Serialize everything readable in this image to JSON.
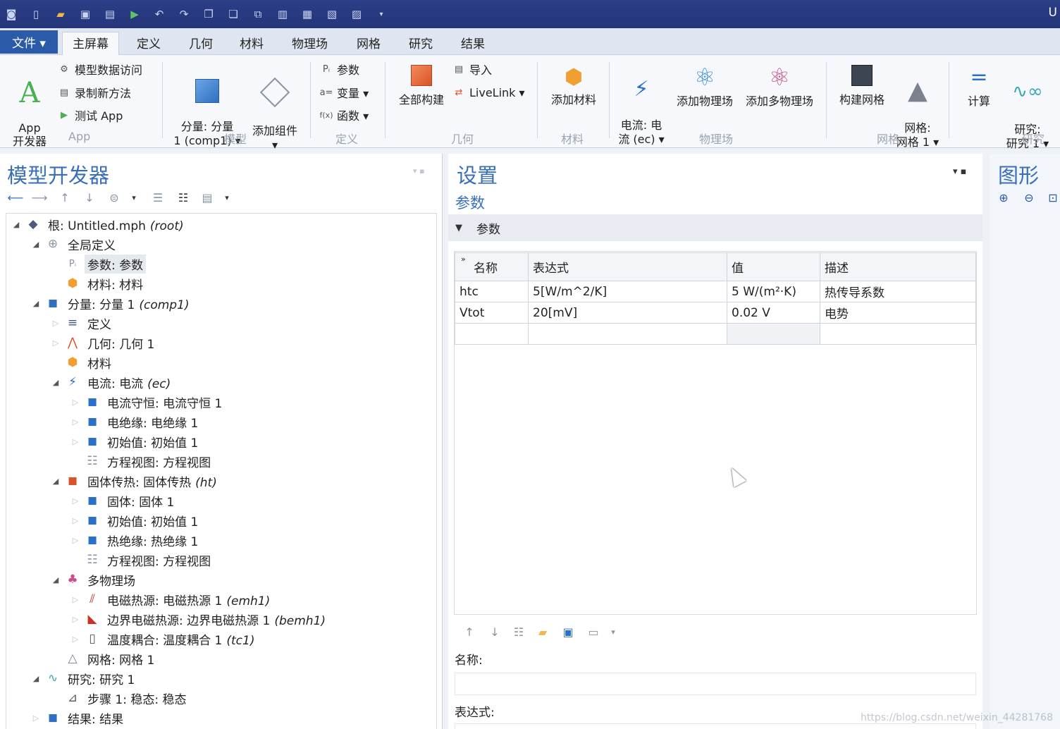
{
  "titlebar": {
    "right_text": "U"
  },
  "tabs": {
    "file": "文件 ▾",
    "items": [
      "主屏幕",
      "定义",
      "几何",
      "材料",
      "物理场",
      "网格",
      "研究",
      "结果"
    ]
  },
  "ribbon": {
    "app_builder": "App\n开发器",
    "model_data_access": "模型数据访问",
    "record_method": "录制新方法",
    "test_app": "测试 App",
    "group_app": "App",
    "component": "分量: 分量\n1 (comp1) ▾",
    "add_component": "添加组件\n▾",
    "group_model": "模型",
    "parameters": "参数",
    "variables": "变量 ▾",
    "functions": "函数 ▾",
    "group_definitions": "定义",
    "build_all": "全部构建",
    "import": "导入",
    "livelink": "LiveLink ▾",
    "group_geometry": "几何",
    "add_material": "添加材料",
    "group_materials": "材料",
    "electric_currents": "电流: 电\n流 (ec) ▾",
    "add_physics": "添加物理场",
    "add_multiphysics": "添加多物理场",
    "group_physics": "物理场",
    "build_mesh": "构建网格",
    "mesh": "网格:\n网格 1 ▾",
    "group_mesh": "网格",
    "compute": "计算",
    "study": "研究:\n研究 1 ▾",
    "group_study": "研究"
  },
  "model_builder": {
    "title": "模型开发器",
    "tree": [
      {
        "label": "根: Untitled.mph",
        "suffix": "(root)"
      },
      {
        "label": "全局定义",
        "suffix": ""
      },
      {
        "label": "参数: 参数",
        "suffix": ""
      },
      {
        "label": "材料: 材料",
        "suffix": ""
      },
      {
        "label": "分量: 分量 1",
        "suffix": "(comp1)"
      },
      {
        "label": "定义",
        "suffix": ""
      },
      {
        "label": "几何: 几何 1",
        "suffix": ""
      },
      {
        "label": "材料",
        "suffix": ""
      },
      {
        "label": "电流: 电流",
        "suffix": "(ec)"
      },
      {
        "label": "电流守恒: 电流守恒 1",
        "suffix": ""
      },
      {
        "label": "电绝缘: 电绝缘 1",
        "suffix": ""
      },
      {
        "label": "初始值: 初始值 1",
        "suffix": ""
      },
      {
        "label": "方程视图: 方程视图",
        "suffix": ""
      },
      {
        "label": "固体传热: 固体传热",
        "suffix": "(ht)"
      },
      {
        "label": "固体: 固体 1",
        "suffix": ""
      },
      {
        "label": "初始值: 初始值 1",
        "suffix": ""
      },
      {
        "label": "热绝缘: 热绝缘 1",
        "suffix": ""
      },
      {
        "label": "方程视图: 方程视图",
        "suffix": ""
      },
      {
        "label": "多物理场",
        "suffix": ""
      },
      {
        "label": "电磁热源: 电磁热源 1",
        "suffix": "(emh1)"
      },
      {
        "label": "边界电磁热源: 边界电磁热源 1",
        "suffix": "(bemh1)"
      },
      {
        "label": "温度耦合: 温度耦合 1",
        "suffix": "(tc1)"
      },
      {
        "label": "网格: 网格 1",
        "suffix": ""
      },
      {
        "label": "研究: 研究 1",
        "suffix": ""
      },
      {
        "label": "步骤 1: 稳态: 稳态",
        "suffix": ""
      },
      {
        "label": "结果: 结果",
        "suffix": ""
      }
    ]
  },
  "settings": {
    "title": "设置",
    "subtitle": "参数",
    "section": "参数",
    "table": {
      "headers": [
        "名称",
        "表达式",
        "值",
        "描述"
      ],
      "rows": [
        [
          "htc",
          "5[W/m^2/K]",
          "5 W/(m²·K)",
          "热传导系数"
        ],
        [
          "Vtot",
          "20[mV]",
          "0.02 V",
          "电势"
        ]
      ]
    },
    "name_label": "名称:",
    "expr_label": "表达式:"
  },
  "graphics": {
    "title": "图形"
  },
  "watermark": "https://blog.csdn.net/weixin_44281768",
  "colors": {
    "accent": "#3a6fb8",
    "title_bar": "#2c3e86",
    "file_tab": "#2a5aa8"
  }
}
